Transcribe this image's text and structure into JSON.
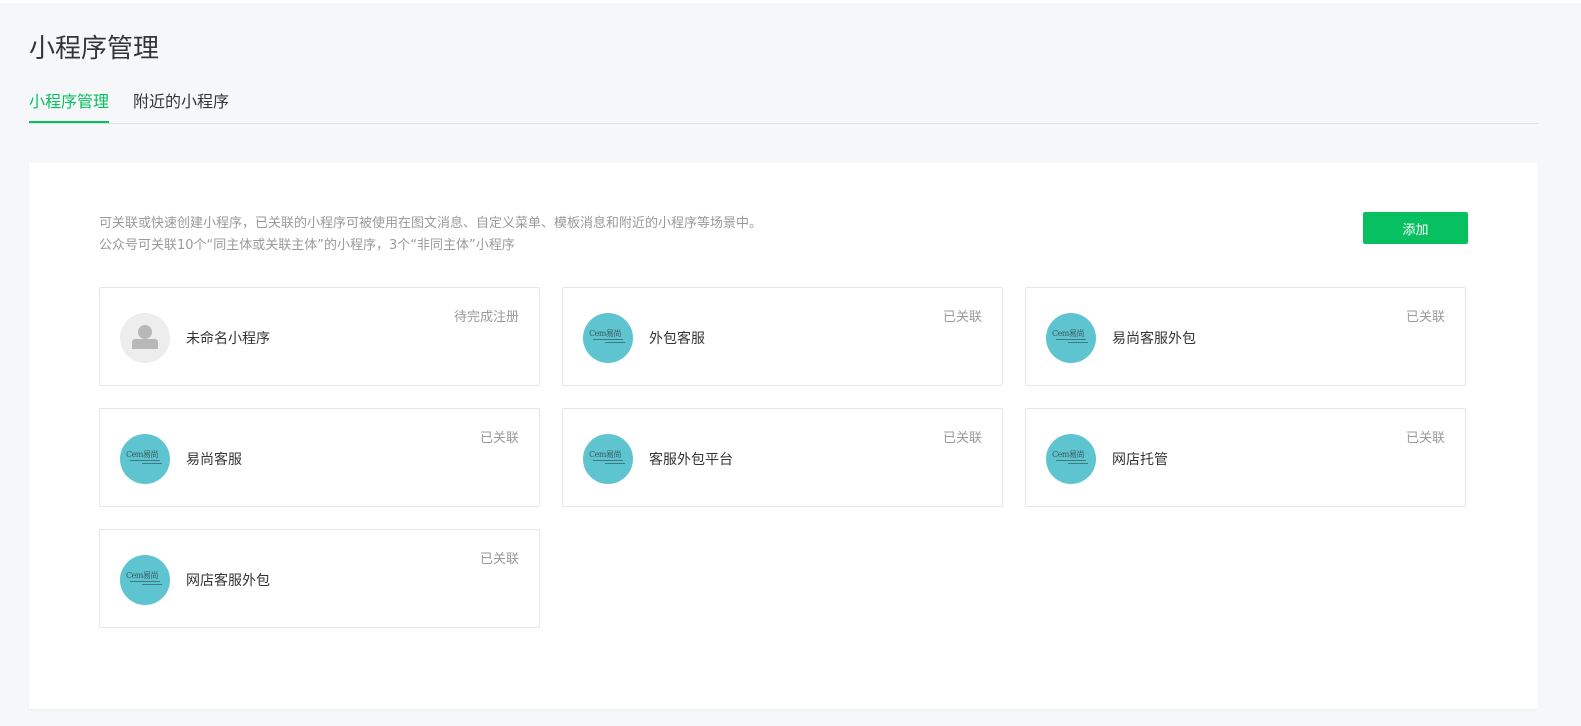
{
  "page": {
    "title": "小程序管理"
  },
  "tabs": [
    {
      "label": "小程序管理",
      "active": true
    },
    {
      "label": "附近的小程序",
      "active": false
    }
  ],
  "panel": {
    "desc_line1": "可关联或快速创建小程序，已关联的小程序可被使用在图文消息、自定义菜单、模板消息和附近的小程序等场景中。",
    "desc_line2": "公众号可关联10个“同主体或关联主体”的小程序，3个“非同主体”小程序",
    "add_label": "添加"
  },
  "cards": [
    {
      "name": "未命名小程序",
      "status": "待完成注册",
      "avatar": "default-user-icon"
    },
    {
      "name": "外包客服",
      "status": "已关联",
      "avatar": "brand-logo"
    },
    {
      "name": "易尚客服外包",
      "status": "已关联",
      "avatar": "brand-logo"
    },
    {
      "name": "易尚客服",
      "status": "已关联",
      "avatar": "brand-logo"
    },
    {
      "name": "客服外包平台",
      "status": "已关联",
      "avatar": "brand-logo"
    },
    {
      "name": "网店托管",
      "status": "已关联",
      "avatar": "brand-logo"
    },
    {
      "name": "网店客服外包",
      "status": "已关联",
      "avatar": "brand-logo"
    }
  ],
  "logo_text": "Cem易尚",
  "colors": {
    "accent": "#07c160",
    "logo_bg": "#5ec4cf",
    "muted": "#9a9a9a"
  }
}
